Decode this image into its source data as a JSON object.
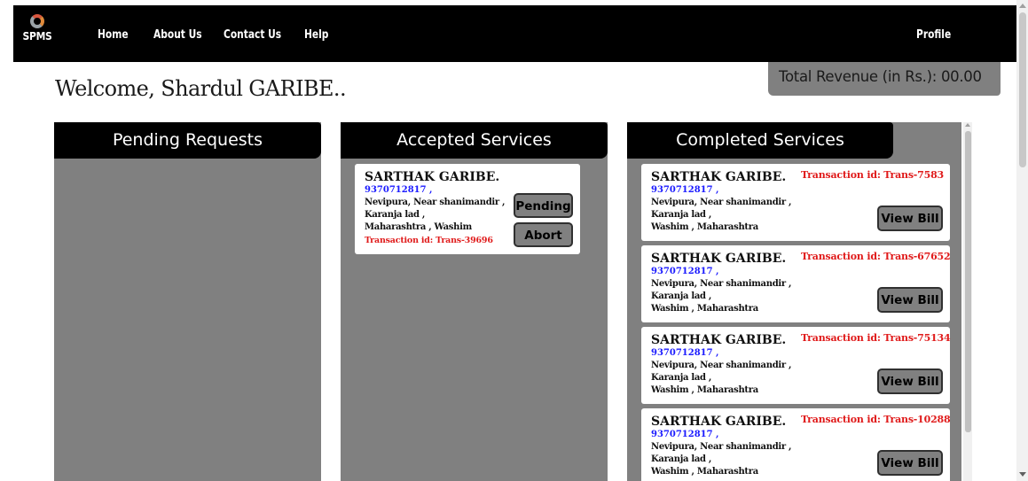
{
  "navbar": {
    "logo_text": "SPMS",
    "links": [
      "Home",
      "About Us",
      "Contact Us",
      "Help"
    ],
    "profile_label": "Profile"
  },
  "revenue": {
    "label": "Total Revenue (in Rs.): 00.00"
  },
  "welcome": "Welcome, Shardul GARIBE..",
  "columns": {
    "pending": {
      "title": "Pending Requests"
    },
    "accepted": {
      "title": "Accepted Services",
      "cards": [
        {
          "name": "SARTHAK GARIBE.",
          "phone": "9370712817 ,",
          "address": [
            "Nevipura, Near shanimandir ,",
            "Karanja lad ,",
            "Maharashtra , Washim"
          ],
          "transaction": "Transaction id: Trans-39696",
          "buttons": [
            "Pending",
            "Abort"
          ]
        }
      ]
    },
    "completed": {
      "title": "Completed Services",
      "cards": [
        {
          "name": "SARTHAK GARIBE.",
          "phone": "9370712817 ,",
          "address": [
            "Nevipura, Near shanimandir ,",
            "Karanja lad ,",
            "Washim , Maharashtra"
          ],
          "transaction": "Transaction id: Trans-7583",
          "button": "View Bill"
        },
        {
          "name": "SARTHAK GARIBE.",
          "phone": "9370712817 ,",
          "address": [
            "Nevipura, Near shanimandir ,",
            "Karanja lad ,",
            "Washim , Maharashtra"
          ],
          "transaction": "Transaction id: Trans-67652",
          "button": "View Bill"
        },
        {
          "name": "SARTHAK GARIBE.",
          "phone": "9370712817 ,",
          "address": [
            "Nevipura, Near shanimandir ,",
            "Karanja lad ,",
            "Washim , Maharashtra"
          ],
          "transaction": "Transaction id: Trans-75134",
          "button": "View Bill"
        },
        {
          "name": "SARTHAK GARIBE.",
          "phone": "9370712817 ,",
          "address": [
            "Nevipura, Near shanimandir ,",
            "Karanja lad ,",
            "Washim , Maharashtra"
          ],
          "transaction": "Transaction id: Trans-10288",
          "button": "View Bill"
        }
      ]
    }
  },
  "colors": {
    "navbar": "#000000",
    "panel": "#808080",
    "phone": "#1a1aff",
    "transaction": "#e01b1b"
  }
}
